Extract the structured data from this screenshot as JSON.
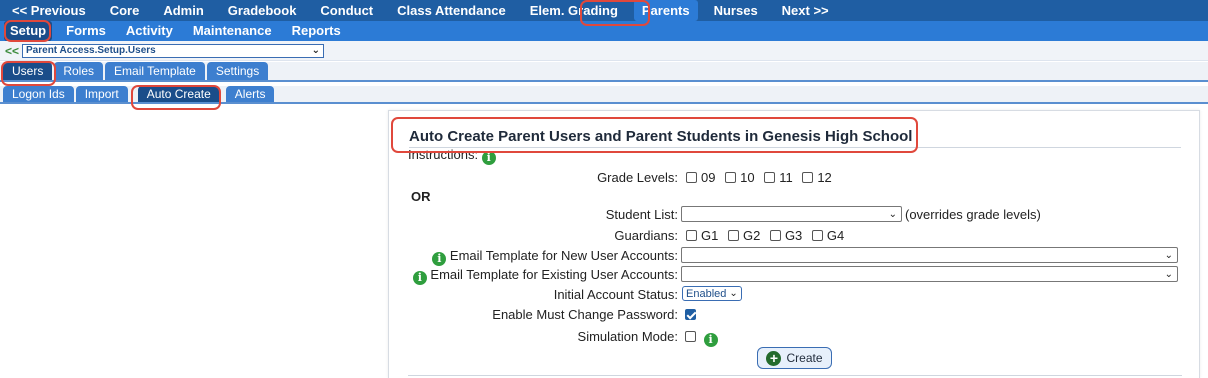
{
  "top_menu": [
    "<< Previous",
    "Core",
    "Admin",
    "Gradebook",
    "Conduct",
    "Class Attendance",
    "Elem. Grading",
    "Parents",
    "Nurses",
    "Next >>"
  ],
  "sub_menu": [
    "Setup",
    "Forms",
    "Activity",
    "Maintenance",
    "Reports"
  ],
  "nav": {
    "back_glyph": "<<",
    "selected_page": "Parent Access.Setup.Users"
  },
  "tabs_row1": [
    "Users",
    "Roles",
    "Email Template",
    "Settings"
  ],
  "tabs_row2": [
    "Logon Ids",
    "Import",
    "Auto Create",
    "Alerts"
  ],
  "panel": {
    "title": "Auto Create Parent Users and Parent Students in Genesis High School",
    "instructions_label": "Instructions:",
    "grade_levels_label": "Grade Levels:",
    "grade_levels": [
      "09",
      "10",
      "11",
      "12"
    ],
    "or_label": "OR",
    "student_list_label": "Student List:",
    "student_list_note": "(overrides grade levels)",
    "guardians_label": "Guardians:",
    "guardians": [
      "G1",
      "G2",
      "G3",
      "G4"
    ],
    "email_new_label": "Email Template for New User Accounts:",
    "email_existing_label": "Email Template for Existing User Accounts:",
    "initial_status_label": "Initial Account Status:",
    "initial_status_value": "Enabled",
    "must_change_label": "Enable Must Change Password:",
    "must_change_checked": true,
    "simulation_label": "Simulation Mode:",
    "simulation_checked": false,
    "create_button": "Create"
  },
  "icons": {
    "info": "info-icon",
    "dropdown": "chevron-down-icon",
    "add": "plus-circle-icon"
  },
  "colors": {
    "top_bar": "#1f5ea3",
    "sub_bar": "#2c7bd6",
    "highlight_ring": "#e0483c",
    "info_green": "#2f9e3e"
  }
}
